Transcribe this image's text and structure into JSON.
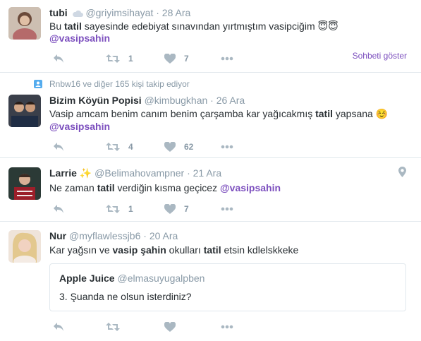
{
  "tweets": [
    {
      "name": "tubi",
      "handle": "@griyimsihayat",
      "date": "· 28 Ara",
      "text_pre": "Bu ",
      "text_bold": "tatil",
      "text_post": " sayesinde edebiyat sınavından yırtmıştım vasipciğim ",
      "emoji": "😇😇",
      "mention": "@vasipsahin",
      "retweets": "1",
      "likes": "7",
      "show_conversation": "Sohbeti göster"
    },
    {
      "context": "Rnbw16 ve diğer 165 kişi takip ediyor",
      "name": "Bizim Köyün Popisi",
      "handle": "@kimbugkhan",
      "date": "· 26 Ara",
      "text_pre": "Vasip amcam benim canım benim çarşamba kar yağıcakmış ",
      "text_bold": "tatil",
      "text_post": " yapsana ",
      "emoji": "☺️",
      "mention": "@vasipsahin",
      "retweets": "4",
      "likes": "62"
    },
    {
      "name": "Larrie",
      "name_emoji": "✨",
      "handle": "@Belimahovampner",
      "date": "· 21 Ara",
      "text_pre": "Ne zaman ",
      "text_bold": "tatil",
      "text_post": " verdiğin kısma geçicez ",
      "mention": "@vasipsahin",
      "retweets": "1",
      "likes": "7"
    },
    {
      "name": "Nur",
      "handle": "@myflawlessjb6",
      "date": "· 20 Ara",
      "text_pre": "Kar yağsın ve ",
      "text_bold": "vasip şahin",
      "text_mid": " okulları ",
      "text_bold2": "tatil",
      "text_post": " etsin kdlelskkeke",
      "quote": {
        "name": "Apple Juice",
        "handle": "@elmasuyugalpben",
        "text": "3. Şuanda ne olsun isterdiniz?"
      }
    }
  ],
  "colors": {
    "accent": "#7c4fbe",
    "muted": "#8899a6",
    "text": "#292f33",
    "border": "#e1e8ed"
  },
  "icons": [
    "reply-icon",
    "retweet-icon",
    "like-icon",
    "more-icon",
    "cloud-icon",
    "location-icon",
    "user-icon"
  ]
}
